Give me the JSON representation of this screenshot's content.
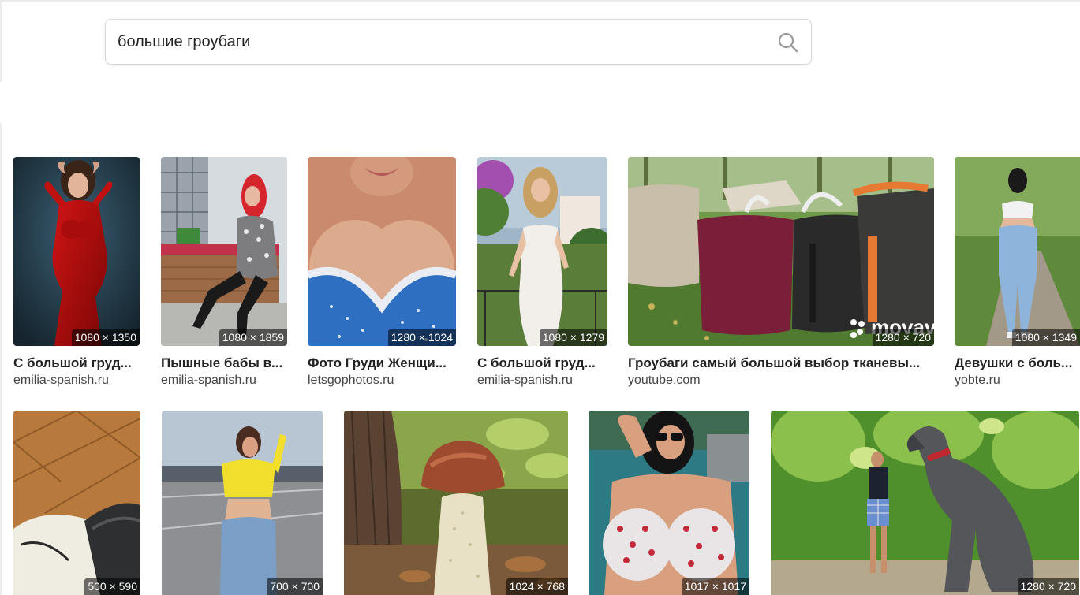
{
  "search": {
    "query": "большие гроубаги"
  },
  "row1": [
    {
      "dims": "1080 × 1350",
      "title": "С большой груд...",
      "domain": "emilia-spanish.ru"
    },
    {
      "dims": "1080 × 1859",
      "title": "Пышные бабы в...",
      "domain": "emilia-spanish.ru"
    },
    {
      "dims": "1280 × 1024",
      "title": "Фото Груди Женщи...",
      "domain": "letsgophotos.ru"
    },
    {
      "dims": "1080 × 1279",
      "title": "С большой груд...",
      "domain": "emilia-spanish.ru"
    },
    {
      "dims": "1280 × 720",
      "title": "Гроубаги самый большой выбор тканевы...",
      "domain": "youtube.com",
      "watermark": "movav"
    },
    {
      "dims": "1080 × 1349",
      "title": "Девушки с боль...",
      "domain": "yobte.ru"
    }
  ],
  "row2": [
    {
      "dims": "500 × 590"
    },
    {
      "dims": "700 × 700"
    },
    {
      "dims": "1024 × 768"
    },
    {
      "dims": "1017 × 1017"
    },
    {
      "dims": "1280 × 720"
    }
  ]
}
